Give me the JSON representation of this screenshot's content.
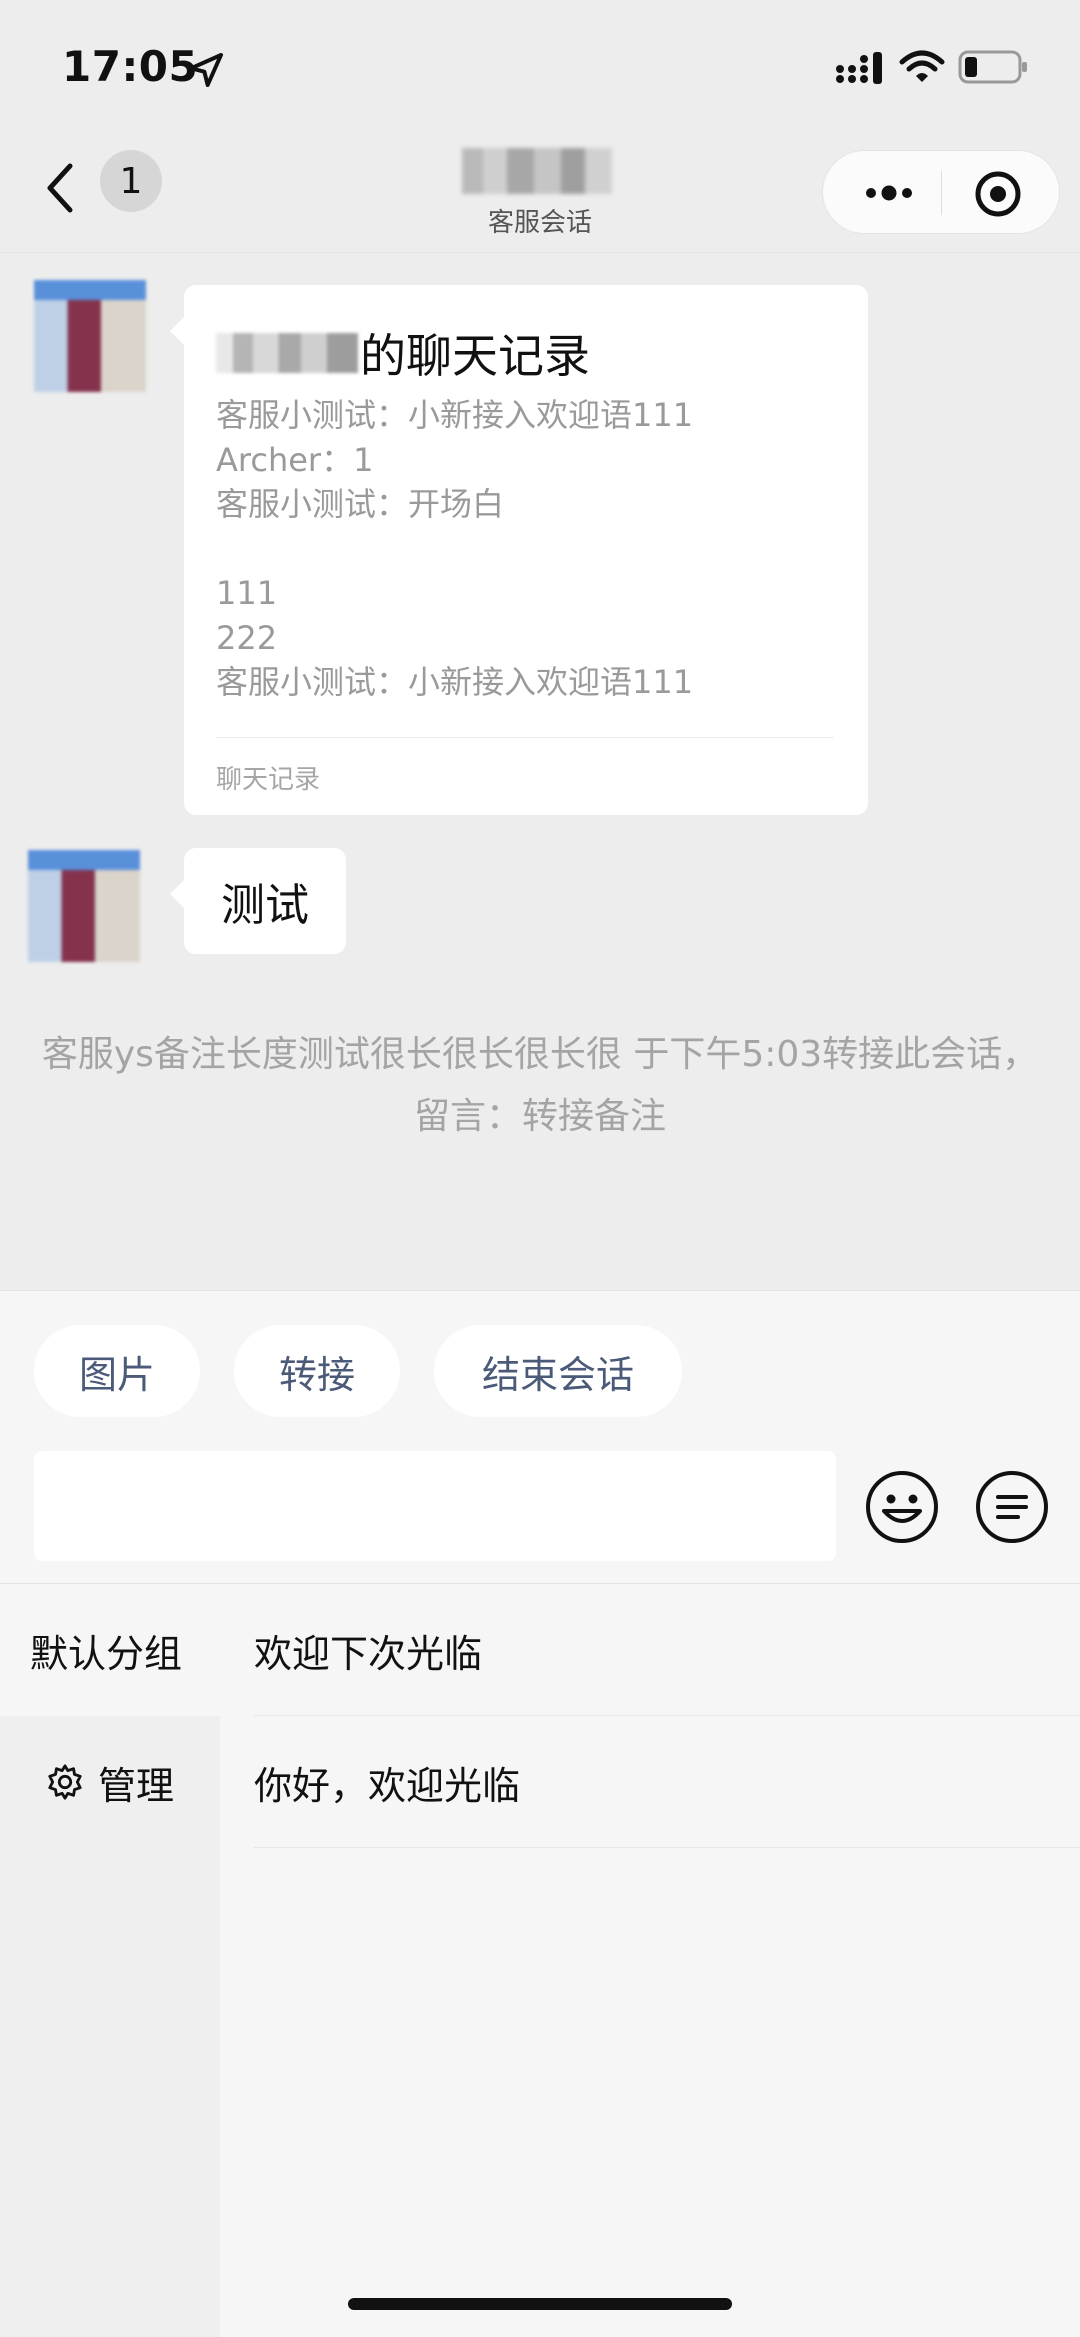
{
  "status_bar": {
    "time": "17:05",
    "icons": [
      "location-arrow-icon",
      "cellular-signal-icon",
      "wifi-icon",
      "battery-icon"
    ]
  },
  "nav": {
    "badge_count": "1",
    "subtitle": "客服会话",
    "icons": [
      "back-chevron-icon",
      "more-dots-icon",
      "target-circle-icon"
    ]
  },
  "chat": {
    "record_card": {
      "title_suffix": "的聊天记录",
      "lines": [
        "客服小测试：小新接入欢迎语111",
        "Archer：1",
        "客服小测试：开场白",
        "",
        "111",
        "222",
        "客服小测试：小新接入欢迎语111"
      ],
      "footer": "聊天记录"
    },
    "message": {
      "text": "测试"
    },
    "system_note": "客服ys备注长度测试很长很长很长很 于下午5:03转接此会话，留言：转接备注"
  },
  "panel": {
    "chips": [
      "图片",
      "转接",
      "结束会话"
    ],
    "input": {
      "value": "",
      "placeholder": ""
    },
    "icons": [
      "emoji-smile-icon",
      "quick-reply-menu-icon"
    ],
    "groups": {
      "active": "默认分组",
      "manage_label": "管理",
      "manage_icon": "gear-icon"
    },
    "quick_replies": [
      "欢迎下次光临",
      "你好，欢迎光临"
    ]
  },
  "colors": {
    "background": "#ededed",
    "panel": "#f6f6f6",
    "chip_text": "#4b5a78",
    "muted_text": "#9a9a9a"
  }
}
